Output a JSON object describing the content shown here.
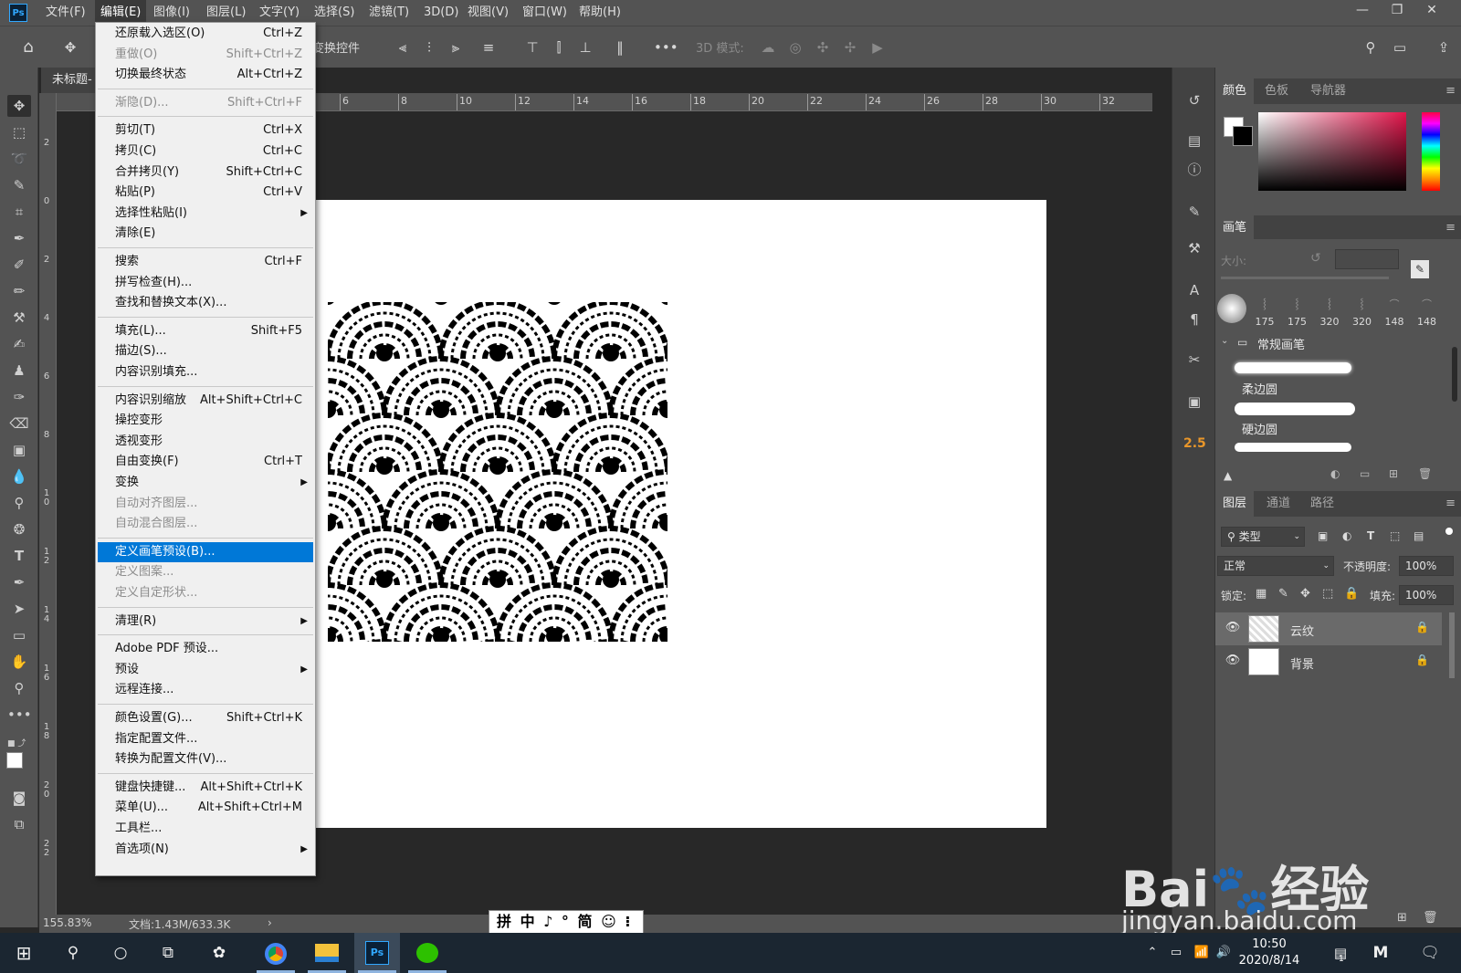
{
  "app": {
    "logo": "Ps"
  },
  "menubar": {
    "items": [
      "文件(F)",
      "编辑(E)",
      "图像(I)",
      "图层(L)",
      "文字(Y)",
      "选择(S)",
      "滤镜(T)",
      "3D(D)",
      "视图(V)",
      "窗口(W)",
      "帮助(H)"
    ],
    "active": "编辑(E)"
  },
  "options_bar": {
    "transform_controls": "变换控件",
    "mode_3d": "3D 模式:"
  },
  "document": {
    "tab_title": "未标题-",
    "zoom": "155.83%",
    "doc_info": "文档:1.43M/633.3K"
  },
  "ruler": {
    "h_labels": [
      "6",
      "8",
      "10",
      "12",
      "14",
      "16",
      "18",
      "20",
      "22",
      "24",
      "26",
      "28",
      "30",
      "32"
    ],
    "v_labels": [
      "2",
      "0",
      "2",
      "4",
      "6",
      "8",
      "1 0",
      "1 2",
      "1 4",
      "1 6",
      "1 8",
      "2 0",
      "2 2"
    ]
  },
  "edit_menu": [
    {
      "label": "还原载入选区(O)",
      "shortcut": "Ctrl+Z",
      "disabled": false
    },
    {
      "label": "重做(O)",
      "shortcut": "Shift+Ctrl+Z",
      "disabled": true
    },
    {
      "label": "切换最终状态",
      "shortcut": "Alt+Ctrl+Z",
      "disabled": false
    },
    {
      "label": "渐隐(D)...",
      "shortcut": "Shift+Ctrl+F",
      "disabled": true
    },
    {
      "label": "剪切(T)",
      "shortcut": "Ctrl+X",
      "disabled": false
    },
    {
      "label": "拷贝(C)",
      "shortcut": "Ctrl+C",
      "disabled": false
    },
    {
      "label": "合并拷贝(Y)",
      "shortcut": "Shift+Ctrl+C",
      "disabled": false
    },
    {
      "label": "粘贴(P)",
      "shortcut": "Ctrl+V",
      "disabled": false
    },
    {
      "label": "选择性粘贴(I)",
      "shortcut": "",
      "disabled": false,
      "submenu": true
    },
    {
      "label": "清除(E)",
      "shortcut": "",
      "disabled": false
    },
    {
      "label": "搜索",
      "shortcut": "Ctrl+F",
      "disabled": false
    },
    {
      "label": "拼写检查(H)...",
      "shortcut": "",
      "disabled": false
    },
    {
      "label": "查找和替换文本(X)...",
      "shortcut": "",
      "disabled": false
    },
    {
      "label": "填充(L)...",
      "shortcut": "Shift+F5",
      "disabled": false
    },
    {
      "label": "描边(S)...",
      "shortcut": "",
      "disabled": false
    },
    {
      "label": "内容识别填充...",
      "shortcut": "",
      "disabled": false
    },
    {
      "label": "内容识别缩放",
      "shortcut": "Alt+Shift+Ctrl+C",
      "disabled": false
    },
    {
      "label": "操控变形",
      "shortcut": "",
      "disabled": false
    },
    {
      "label": "透视变形",
      "shortcut": "",
      "disabled": false
    },
    {
      "label": "自由变换(F)",
      "shortcut": "Ctrl+T",
      "disabled": false
    },
    {
      "label": "变换",
      "shortcut": "",
      "disabled": false,
      "submenu": true
    },
    {
      "label": "自动对齐图层...",
      "shortcut": "",
      "disabled": true
    },
    {
      "label": "自动混合图层...",
      "shortcut": "",
      "disabled": true
    },
    {
      "label": "定义画笔预设(B)...",
      "shortcut": "",
      "disabled": false,
      "highlighted": true
    },
    {
      "label": "定义图案...",
      "shortcut": "",
      "disabled": true
    },
    {
      "label": "定义自定形状...",
      "shortcut": "",
      "disabled": true
    },
    {
      "label": "清理(R)",
      "shortcut": "",
      "disabled": false,
      "submenu": true
    },
    {
      "label": "Adobe PDF 预设...",
      "shortcut": "",
      "disabled": false
    },
    {
      "label": "预设",
      "shortcut": "",
      "disabled": false,
      "submenu": true
    },
    {
      "label": "远程连接...",
      "shortcut": "",
      "disabled": false
    },
    {
      "label": "颜色设置(G)...",
      "shortcut": "Shift+Ctrl+K",
      "disabled": false
    },
    {
      "label": "指定配置文件...",
      "shortcut": "",
      "disabled": false
    },
    {
      "label": "转换为配置文件(V)...",
      "shortcut": "",
      "disabled": false
    },
    {
      "label": "键盘快捷键...",
      "shortcut": "Alt+Shift+Ctrl+K",
      "disabled": false
    },
    {
      "label": "菜单(U)...",
      "shortcut": "Alt+Shift+Ctrl+M",
      "disabled": false
    },
    {
      "label": "工具栏...",
      "shortcut": "",
      "disabled": false
    },
    {
      "label": "首选项(N)",
      "shortcut": "",
      "disabled": false,
      "submenu": true
    }
  ],
  "right_strip": {
    "value_badge": "2.5"
  },
  "color_panel": {
    "tabs": [
      "颜色",
      "色板",
      "导航器"
    ],
    "fg_color": "#ffffff",
    "bg_color": "#000000",
    "hue_color": "#e1144a"
  },
  "brush_panel": {
    "title": "画笔",
    "size_label": "大小:",
    "recent_sizes": [
      "175",
      "175",
      "320",
      "320",
      "148",
      "148"
    ],
    "group_name": "常规画笔",
    "brushes": [
      "柔边圆",
      "硬边圆"
    ]
  },
  "layers_panel": {
    "tabs": [
      "图层",
      "通道",
      "路径"
    ],
    "filter_kind": "类型",
    "blend_mode": "正常",
    "opacity_label": "不透明度:",
    "opacity": "100%",
    "lock_label": "锁定:",
    "fill_label": "填充:",
    "fill": "100%",
    "layers": [
      {
        "name": "云纹",
        "selected": true
      },
      {
        "name": "背景",
        "selected": false
      }
    ]
  },
  "ime": {
    "text": "拼 中 ♪ ° 简 ☺ ⁝"
  },
  "taskbar": {
    "time": "10:50",
    "date": "2020/8/14",
    "notif_count": "1"
  },
  "watermark": {
    "logo": "Bai🐾经验",
    "url": "jingyan.baidu.com"
  }
}
